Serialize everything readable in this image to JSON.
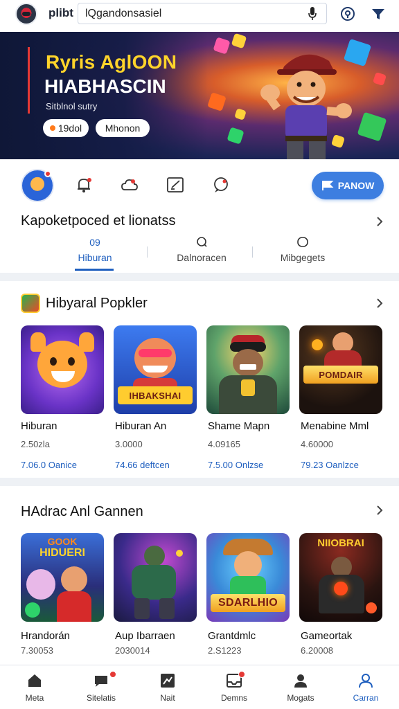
{
  "topbar": {
    "app_name": "plibt",
    "search_value": "lQgandonsasiel",
    "icons": [
      "app-logo",
      "mic-icon",
      "location-icon",
      "filter-icon"
    ]
  },
  "banner": {
    "title": "Ryris AglOON",
    "subtitle": "HIABHASCIN",
    "tagline": "Sitblnol sutry",
    "chip_fire": "19dol",
    "chip_mission": "Mhonon",
    "colors": {
      "title": "#ffd42a",
      "accent": "#e53935"
    }
  },
  "quick_actions": {
    "icons": [
      "avatar",
      "notification-bell-icon",
      "cloud-alert-icon",
      "edit-note-icon",
      "chat-bubble-icon"
    ],
    "play_button": "PANOW"
  },
  "category": {
    "title": "Kapoketpoced et lionatss",
    "tabs": [
      {
        "label": "Hiburan",
        "badge": "09",
        "active": true
      },
      {
        "label": "Dalnoracen",
        "active": false
      },
      {
        "label": "Mibgegets",
        "active": false
      }
    ]
  },
  "section1": {
    "title": "Hibyaral Popkler",
    "cards": [
      {
        "title": "Hiburan",
        "meta": "2.50zla",
        "price": "7.06.0 Oanice",
        "art_text": ""
      },
      {
        "title": "Hiburan An",
        "meta": "3.0000",
        "price": "74.66 deftcen",
        "art_text": "IHBAKSHAI"
      },
      {
        "title": "Shame Mapn",
        "meta": "4.09165",
        "price": "7.5.00 Onlzse",
        "art_text": ""
      },
      {
        "title": "Menabine Mml",
        "meta": "4.60000",
        "price": "79.23 Oanlzce",
        "art_text": "POMDAIR"
      }
    ]
  },
  "section2": {
    "title": "HAdrac Anl Gannen",
    "cards": [
      {
        "title": "Hrandorán",
        "meta": "7.30053",
        "art_text": "HIDUERI",
        "art_top": "GOOK"
      },
      {
        "title": "Aup Ibarraen",
        "meta": "2030014",
        "art_text": ""
      },
      {
        "title": "Grantdmlc",
        "meta": "2.S1223",
        "art_text": "SDARLHIO"
      },
      {
        "title": "Gameortak",
        "meta": "6.20008",
        "art_text": "NIIOBRAI"
      }
    ]
  },
  "bottom_nav": [
    {
      "label": "Meta",
      "icon": "home-icon"
    },
    {
      "label": "Sitelatis",
      "icon": "chat-icon",
      "badge": true
    },
    {
      "label": "Nait",
      "icon": "stats-icon"
    },
    {
      "label": "Demns",
      "icon": "inbox-icon",
      "badge": true
    },
    {
      "label": "Mogats",
      "icon": "profile-icon"
    },
    {
      "label": "Carran",
      "icon": "account-icon",
      "active": true
    }
  ],
  "colors": {
    "accent_blue": "#1f5fbf",
    "play_button": "#3d7ee0",
    "badge_red": "#e53935"
  }
}
